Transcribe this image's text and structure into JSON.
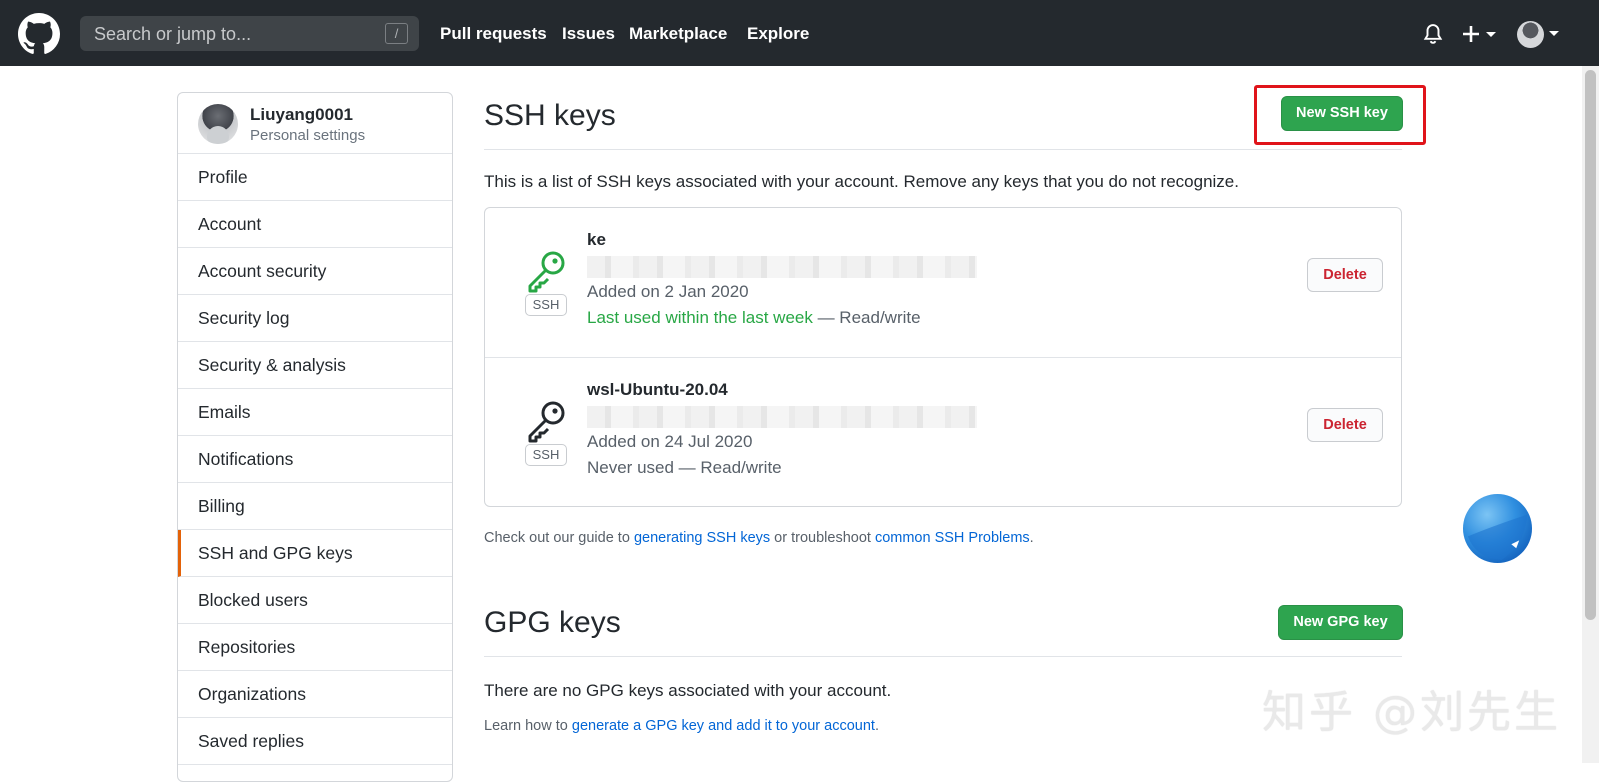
{
  "header": {
    "search_placeholder": "Search or jump to...",
    "slash_hint": "/",
    "nav": [
      "Pull requests",
      "Issues",
      "Marketplace",
      "Explore"
    ]
  },
  "sidebar": {
    "username": "Liuyang0001",
    "subtitle": "Personal settings",
    "items": [
      {
        "label": "Profile"
      },
      {
        "label": "Account"
      },
      {
        "label": "Account security"
      },
      {
        "label": "Security log"
      },
      {
        "label": "Security & analysis"
      },
      {
        "label": "Emails"
      },
      {
        "label": "Notifications"
      },
      {
        "label": "Billing"
      },
      {
        "label": "SSH and GPG keys",
        "active": true
      },
      {
        "label": "Blocked users"
      },
      {
        "label": "Repositories"
      },
      {
        "label": "Organizations"
      },
      {
        "label": "Saved replies"
      }
    ]
  },
  "ssh": {
    "heading": "SSH keys",
    "new_button": "New SSH key",
    "intro": "This is a list of SSH keys associated with your account. Remove any keys that you do not recognize.",
    "keys": [
      {
        "title": "ke",
        "badge": "SSH",
        "added": "Added on 2 Jan 2020",
        "last_used": "Last used within the last week",
        "access": " — Read/write",
        "delete_label": "Delete"
      },
      {
        "title": "wsl-Ubuntu-20.04",
        "badge": "SSH",
        "added": "Added on 24 Jul 2020",
        "last_used": "Never used",
        "access": " — Read/write",
        "delete_label": "Delete"
      }
    ],
    "guide_prefix": "Check out our guide to ",
    "guide_link1": "generating SSH keys",
    "guide_mid": " or troubleshoot ",
    "guide_link2": "common SSH Problems",
    "guide_suffix": "."
  },
  "gpg": {
    "heading": "GPG keys",
    "new_button": "New GPG key",
    "empty": "There are no GPG keys associated with your account.",
    "learn_prefix": "Learn how to ",
    "learn_link": "generate a GPG key and add it to your account",
    "learn_suffix": "."
  },
  "watermark": "知乎 @刘先生",
  "colors": {
    "header_bg": "#24292e",
    "primary_green": "#2ea44f",
    "danger_red": "#cb2431",
    "link_blue": "#0366d6",
    "highlight_red": "#e0141a",
    "active_orange": "#e36209"
  }
}
